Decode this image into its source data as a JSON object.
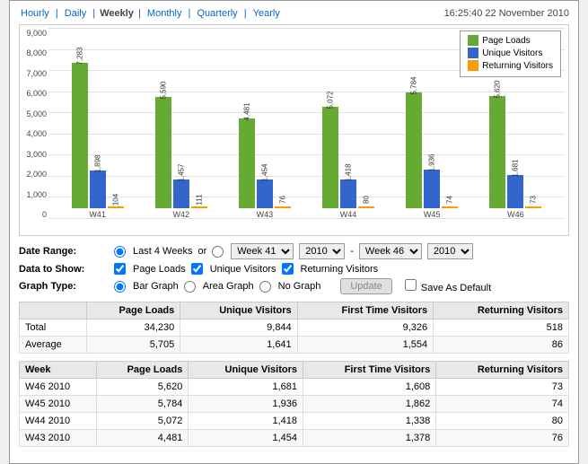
{
  "topBar": {
    "periods": [
      {
        "label": "Hourly",
        "selected": false
      },
      {
        "label": "Daily",
        "selected": false
      },
      {
        "label": "Weekly",
        "selected": true
      },
      {
        "label": "Monthly",
        "selected": false
      },
      {
        "label": "Quarterly",
        "selected": false
      },
      {
        "label": "Yearly",
        "selected": false
      }
    ],
    "timestamp": "16:25:40  22 November 2010"
  },
  "chart": {
    "yLabels": [
      "0",
      "1,000",
      "2,000",
      "3,000",
      "4,000",
      "5,000",
      "6,000",
      "7,000",
      "8,000",
      "9,000"
    ],
    "maxVal": 9000,
    "groups": [
      {
        "label": "W41",
        "pageLoads": 7283,
        "uniqueVisitors": 1898,
        "returningVisitors": 104
      },
      {
        "label": "W42",
        "pageLoads": 5590,
        "uniqueVisitors": 1457,
        "returningVisitors": 111
      },
      {
        "label": "W43",
        "pageLoads": 4481,
        "uniqueVisitors": 1454,
        "returningVisitors": 76
      },
      {
        "label": "W44",
        "pageLoads": 5072,
        "uniqueVisitors": 1418,
        "returningVisitors": 80
      },
      {
        "label": "W45",
        "pageLoads": 5784,
        "uniqueVisitors": 1936,
        "returningVisitors": 74
      },
      {
        "label": "W46",
        "pageLoads": 5620,
        "uniqueVisitors": 1681,
        "returningVisitors": 73
      }
    ],
    "legend": [
      {
        "label": "Page Loads",
        "color": "#66aa33"
      },
      {
        "label": "Unique Visitors",
        "color": "#3366cc"
      },
      {
        "label": "Returning Visitors",
        "color": "#ff9900"
      }
    ]
  },
  "controls": {
    "dateRange": {
      "label": "Date Range:",
      "option1": "Last 4 Weeks",
      "orText": "or",
      "weekFrom": "Week 41",
      "yearFrom": "2010",
      "dash": "-",
      "weekTo": "Week 46",
      "yearTo": "2010"
    },
    "dataToShow": {
      "label": "Data to Show:",
      "items": [
        "Page Loads",
        "Unique Visitors",
        "Returning Visitors"
      ]
    },
    "graphType": {
      "label": "Graph Type:",
      "options": [
        "Bar Graph",
        "Area Graph",
        "No Graph"
      ],
      "selected": "Bar Graph"
    },
    "updateBtn": "Update",
    "saveDefault": "Save As Default"
  },
  "summaryTable": {
    "headers": [
      "",
      "Page Loads",
      "Unique Visitors",
      "First Time Visitors",
      "Returning Visitors"
    ],
    "rows": [
      {
        "label": "Total",
        "pageLoads": "34,230",
        "uniqueVisitors": "9,844",
        "firstTime": "9,326",
        "returning": "518"
      },
      {
        "label": "Average",
        "pageLoads": "5,705",
        "uniqueVisitors": "1,641",
        "firstTime": "1,554",
        "returning": "86"
      }
    ]
  },
  "detailTable": {
    "headers": [
      "Week",
      "Page Loads",
      "Unique Visitors",
      "First Time Visitors",
      "Returning Visitors"
    ],
    "rows": [
      {
        "label": "W46 2010",
        "pageLoads": "5,620",
        "uniqueVisitors": "1,681",
        "firstTime": "1,608",
        "returning": "73"
      },
      {
        "label": "W45 2010",
        "pageLoads": "5,784",
        "uniqueVisitors": "1,936",
        "firstTime": "1,862",
        "returning": "74"
      },
      {
        "label": "W44 2010",
        "pageLoads": "5,072",
        "uniqueVisitors": "1,418",
        "firstTime": "1,338",
        "returning": "80"
      },
      {
        "label": "W43 2010",
        "pageLoads": "4,481",
        "uniqueVisitors": "1,454",
        "firstTime": "1,378",
        "returning": "76"
      }
    ]
  }
}
